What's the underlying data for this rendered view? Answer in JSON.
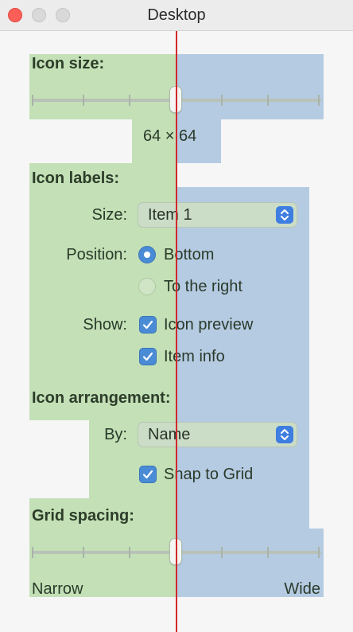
{
  "window": {
    "title": "Desktop"
  },
  "icon_size": {
    "heading": "Icon size:",
    "value_text": "64 × 64",
    "level": 0.5
  },
  "icon_labels": {
    "heading": "Icon labels:",
    "size_label": "Size:",
    "size_value": "Item 1",
    "position_label": "Position:",
    "position_options": [
      "Bottom",
      "To the right"
    ],
    "position_selected": "Bottom",
    "show_label": "Show:",
    "show_options": [
      {
        "label": "Icon preview",
        "checked": true
      },
      {
        "label": "Item info",
        "checked": true
      }
    ]
  },
  "icon_arrangement": {
    "heading": "Icon arrangement:",
    "by_label": "By:",
    "by_value": "Name",
    "snap_label": "Snap to Grid",
    "snap_checked": true
  },
  "grid_spacing": {
    "heading": "Grid spacing:",
    "min_label": "Narrow",
    "max_label": "Wide",
    "level": 0.5
  },
  "colors": {
    "left_overlay": "#c3e0b6",
    "right_overlay": "#b5cbe2",
    "guide_line": "#d2282c",
    "accent": "#4a8bd6"
  }
}
